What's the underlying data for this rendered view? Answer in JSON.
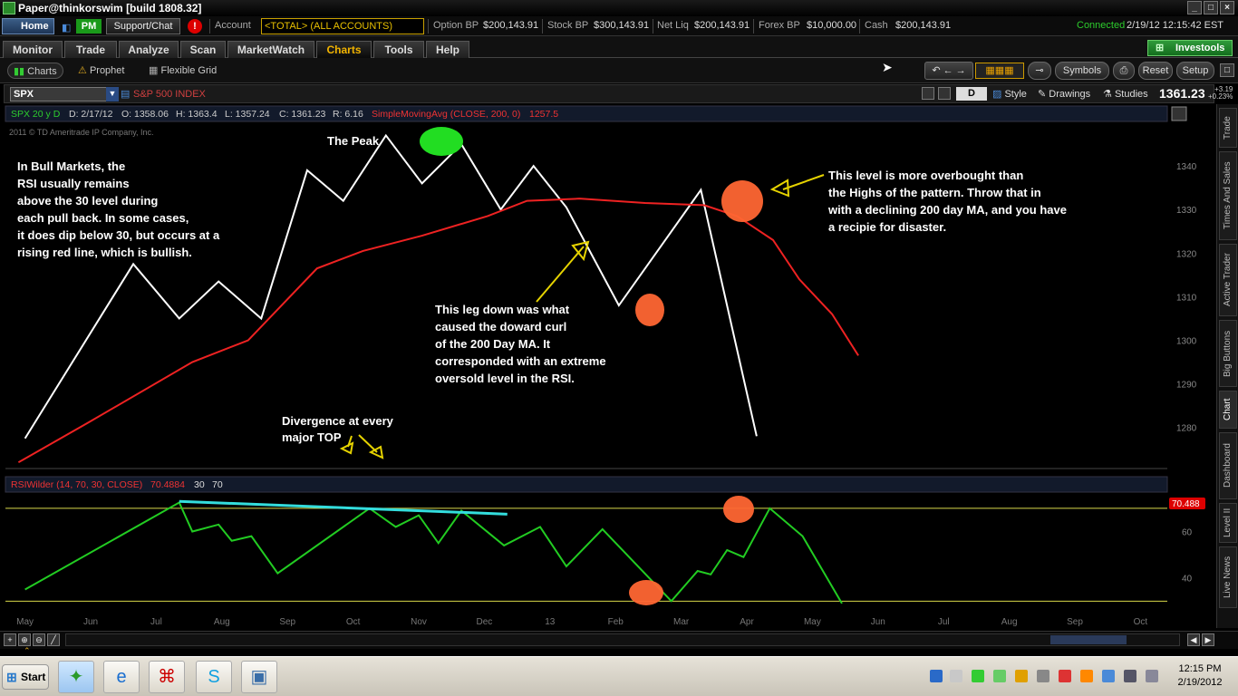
{
  "window": {
    "title": "Paper@thinkorswim [build 1808.32]"
  },
  "account_bar": {
    "home": "Home",
    "pm": "PM",
    "support": "Support/Chat",
    "alert": "!",
    "account_label": "Account",
    "account_value": "<TOTAL> (ALL ACCOUNTS)",
    "option_bp_label": "Option BP",
    "option_bp": "$200,143.91",
    "stock_bp_label": "Stock BP",
    "stock_bp": "$300,143.91",
    "net_liq_label": "Net Liq",
    "net_liq": "$200,143.91",
    "forex_bp_label": "Forex BP",
    "forex_bp": "$10,000.00",
    "cash_label": "Cash",
    "cash": "$200,143.91",
    "status": "Connected",
    "datetime": "2/19/12 12:15:42 EST"
  },
  "menu": {
    "tabs": [
      "Monitor",
      "Trade",
      "Analyze",
      "Scan",
      "MarketWatch",
      "Charts",
      "Tools",
      "Help"
    ],
    "active": "Charts",
    "investools": "Investools"
  },
  "subbar": {
    "tabs": [
      "Charts",
      "Prophet",
      "Flexible Grid"
    ],
    "buttons": {
      "symbols": "Symbols",
      "reset": "Reset",
      "setup": "Setup"
    }
  },
  "symbol_bar": {
    "symbol": "SPX",
    "name": "S&P 500 INDEX",
    "period": "D",
    "style": "Style",
    "drawings": "Drawings",
    "studies": "Studies",
    "last": "1361.23",
    "change": "+3.19",
    "change_pct": "+0.23%"
  },
  "chart_header": {
    "title": "SPX 20 y D",
    "d": "D: 2/17/12",
    "o": "O: 1358.06",
    "h": "H: 1363.4",
    "l": "L: 1357.24",
    "c": "C: 1361.23",
    "r": "R: 6.16",
    "study": "SimpleMovingAvg (CLOSE, 200, 0)",
    "study_val": "1257.5",
    "copyright": "2011 © TD Ameritrade IP Company, Inc."
  },
  "rsi_header": {
    "study": "RSIWilder (14, 70, 30, CLOSE)",
    "val": "70.4884",
    "lo": "30",
    "hi": "70",
    "badge": "70.488"
  },
  "annotations": {
    "peak": "The Peak",
    "bull": [
      "In Bull Markets, the",
      "RSI usually remains",
      "above the 30 level during",
      "each pull back. In some cases,",
      "it does dip below 30, but occurs at a",
      "rising red line, which is bullish."
    ],
    "leg": [
      "This leg down was what",
      "caused the doward curl",
      "of the 200 Day MA. It",
      "corresponded with an extreme",
      "oversold level in the RSI."
    ],
    "overbought": [
      "This level is more overbought than",
      "the Highs of the pattern. Throw that in",
      "with a declining 200 day MA, and you have",
      "a recipie for disaster."
    ],
    "divergence": [
      "Divergence at every",
      "major TOP"
    ]
  },
  "chart_data": {
    "type": "line",
    "price_axis": {
      "ticks": [
        1280,
        1290,
        1300,
        1310,
        1320,
        1330,
        1340
      ],
      "ylim": [
        1271,
        1350
      ]
    },
    "rsi_axis": {
      "ticks": [
        40,
        60
      ],
      "ylim": [
        27,
        77
      ]
    },
    "months": [
      "May",
      "Jun",
      "Jul",
      "Aug",
      "Sep",
      "Oct",
      "Nov",
      "Dec",
      "13",
      "Feb",
      "Mar",
      "Apr",
      "May",
      "Jun",
      "Jul",
      "Aug",
      "Sep",
      "Oct"
    ],
    "series": [
      {
        "color": "#ffffff",
        "points": [
          [
            0.05,
            1277.5
          ],
          [
            1.7,
            1317.5
          ],
          [
            2.4,
            1305
          ],
          [
            3,
            1313.5
          ],
          [
            3.65,
            1305
          ],
          [
            4.35,
            1339
          ],
          [
            4.9,
            1332
          ],
          [
            5.55,
            1347
          ],
          [
            6.1,
            1336
          ],
          [
            6.7,
            1345
          ],
          [
            7.3,
            1330
          ],
          [
            7.8,
            1340
          ],
          [
            8.3,
            1330.5
          ],
          [
            9.1,
            1308
          ],
          [
            10.35,
            1334.5
          ],
          [
            11.2,
            1278
          ]
        ]
      },
      {
        "color": "#ee2222",
        "points": [
          [
            -0.05,
            1272
          ],
          [
            1.0,
            1281
          ],
          [
            2.6,
            1295
          ],
          [
            3.45,
            1300
          ],
          [
            4.5,
            1316.5
          ],
          [
            5.2,
            1320.5
          ],
          [
            6.1,
            1324
          ],
          [
            7.1,
            1328.5
          ],
          [
            7.7,
            1332
          ],
          [
            8.5,
            1332.5
          ],
          [
            9.5,
            1331.5
          ],
          [
            10.4,
            1331
          ],
          [
            10.9,
            1328.5
          ],
          [
            11.45,
            1323
          ],
          [
            11.85,
            1314
          ],
          [
            12.35,
            1306
          ],
          [
            12.75,
            1296.5
          ]
        ]
      },
      {
        "name": "RSIWilder",
        "color": "#22cc22",
        "points": [
          [
            0.05,
            35
          ],
          [
            2.4,
            72.5
          ],
          [
            2.6,
            60
          ],
          [
            3,
            63
          ],
          [
            3.2,
            56
          ],
          [
            3.5,
            58
          ],
          [
            3.9,
            42
          ],
          [
            5.3,
            70
          ],
          [
            5.7,
            62
          ],
          [
            6.05,
            67
          ],
          [
            6.35,
            55
          ],
          [
            6.7,
            69
          ],
          [
            7.35,
            54
          ],
          [
            7.9,
            62
          ],
          [
            8.3,
            45
          ],
          [
            8.85,
            61
          ],
          [
            9.9,
            30
          ],
          [
            10.3,
            43
          ],
          [
            10.5,
            41.5
          ],
          [
            10.75,
            52
          ],
          [
            11,
            49
          ],
          [
            11.4,
            70
          ],
          [
            11.9,
            58
          ],
          [
            12.5,
            29
          ]
        ]
      },
      {
        "name": "divergence",
        "color": "#33dddd",
        "points": [
          [
            2.4,
            73
          ],
          [
            7.4,
            67.5
          ]
        ]
      }
    ],
    "rsi_levels": [
      70,
      30
    ]
  }
}
